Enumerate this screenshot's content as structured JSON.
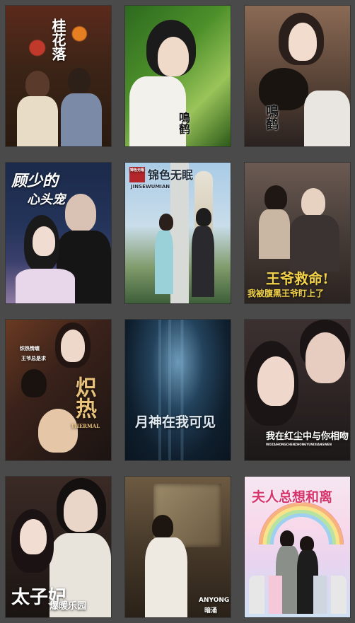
{
  "posters": [
    {
      "id": "p1",
      "texts": [
        "桂花落"
      ]
    },
    {
      "id": "p2",
      "texts": [
        "鳴鹤"
      ]
    },
    {
      "id": "p3",
      "texts": [
        "鳴鹤"
      ]
    },
    {
      "id": "p4",
      "texts": [
        "顾少的",
        "心头宠"
      ]
    },
    {
      "id": "p5",
      "texts": [
        "锦色无眠",
        "锦色无眠",
        "JINSEWUMIAN"
      ]
    },
    {
      "id": "p6",
      "texts": [
        "王爷救命!",
        "我被腹黑王爷盯上了"
      ]
    },
    {
      "id": "p7",
      "texts": [
        "炽热",
        "THERMAL",
        "炽热情缠",
        "王爷总是求"
      ]
    },
    {
      "id": "p8",
      "texts": [
        "月神在我可见"
      ]
    },
    {
      "id": "p9",
      "texts": [
        "我在红尘中与你相吻",
        "WOZAIHONGCHENZHONGYUNIXIANGWEN"
      ]
    },
    {
      "id": "p10",
      "texts": [
        "太子妃",
        "爆暖乐园"
      ]
    },
    {
      "id": "p11",
      "texts": [
        "ANYONG",
        "暗涌"
      ]
    },
    {
      "id": "p12",
      "texts": [
        "夫人总想和离"
      ]
    }
  ]
}
